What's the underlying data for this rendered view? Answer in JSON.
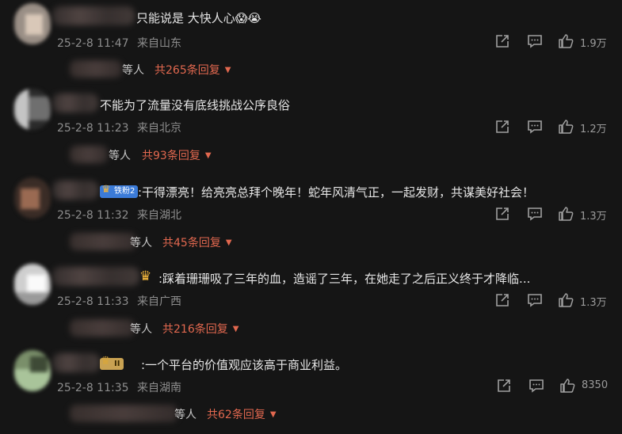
{
  "comments": [
    {
      "text": "只能说是 大快人心😱😭",
      "date": "25-2-8 11:47",
      "location": "来自山东",
      "likes": "1.9万",
      "reply_word": "等人",
      "reply_count": "共265条回复",
      "badge": ""
    },
    {
      "text": "不能为了流量没有底线挑战公序良俗",
      "date": "25-2-8 11:23",
      "location": "来自北京",
      "likes": "1.2万",
      "reply_word": "等人",
      "reply_count": "共93条回复",
      "badge": ""
    },
    {
      "text": ":干得漂亮！给亮亮总拜个晚年！蛇年风清气正，一起发财，共谋美好社会！",
      "date": "25-2-8 11:32",
      "location": "来自湖北",
      "likes": "1.3万",
      "reply_word": "等人",
      "reply_count": "共45条回复",
      "badge": "铁粉2"
    },
    {
      "text": ":踩着珊珊吸了三年的血，造谣了三年，在她走了之后正义终于才降临...",
      "date": "25-2-8 11:33",
      "location": "来自广西",
      "likes": "1.3万",
      "reply_word": "等人",
      "reply_count": "共216条回复",
      "badge": ""
    },
    {
      "text": ":一个平台的价值观应该高于商业利益。",
      "date": "25-2-8 11:35",
      "location": "来自湖南",
      "likes": "8350",
      "reply_word": "等人",
      "reply_count": "共62条回复",
      "badge": "II"
    }
  ],
  "icons": {
    "share": "share-icon",
    "comment": "comment-icon",
    "like": "thumbs-up-icon",
    "crown": "crown-icon",
    "caret": "caret-down-icon"
  },
  "colors": {
    "background": "#151515",
    "reply_accent": "#e2684f",
    "meta": "#8d8d8d",
    "badge_blue": "#3b7bd8",
    "crown_gold": "#f2b63c"
  }
}
